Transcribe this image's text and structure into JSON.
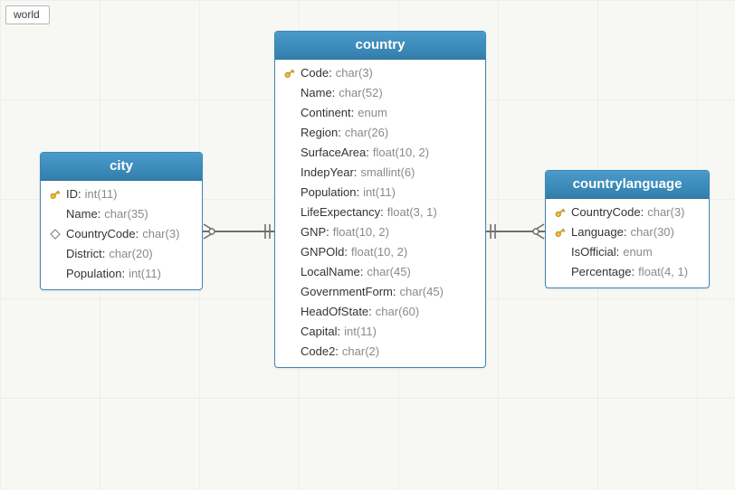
{
  "tab_label": "world",
  "colors": {
    "header": "#3b8ab8",
    "border": "#3f87b2"
  },
  "connectors": [
    {
      "from": "city.CountryCode",
      "to": "country.Code",
      "cardinality": "many-to-one"
    },
    {
      "from": "countrylanguage.CountryCode",
      "to": "country.Code",
      "cardinality": "many-to-one"
    }
  ],
  "entities": {
    "city": {
      "title": "city",
      "columns": [
        {
          "icon": "key",
          "name": "ID",
          "type": "int(11)"
        },
        {
          "icon": "none",
          "name": "Name",
          "type": "char(35)"
        },
        {
          "icon": "diamond",
          "name": "CountryCode",
          "type": "char(3)"
        },
        {
          "icon": "none",
          "name": "District",
          "type": "char(20)"
        },
        {
          "icon": "none",
          "name": "Population",
          "type": "int(11)"
        }
      ]
    },
    "country": {
      "title": "country",
      "columns": [
        {
          "icon": "key",
          "name": "Code",
          "type": "char(3)"
        },
        {
          "icon": "none",
          "name": "Name",
          "type": "char(52)"
        },
        {
          "icon": "none",
          "name": "Continent",
          "type": "enum"
        },
        {
          "icon": "none",
          "name": "Region",
          "type": "char(26)"
        },
        {
          "icon": "none",
          "name": "SurfaceArea",
          "type": "float(10, 2)"
        },
        {
          "icon": "none",
          "name": "IndepYear",
          "type": "smallint(6)"
        },
        {
          "icon": "none",
          "name": "Population",
          "type": "int(11)"
        },
        {
          "icon": "none",
          "name": "LifeExpectancy",
          "type": "float(3, 1)"
        },
        {
          "icon": "none",
          "name": "GNP",
          "type": "float(10, 2)"
        },
        {
          "icon": "none",
          "name": "GNPOld",
          "type": "float(10, 2)"
        },
        {
          "icon": "none",
          "name": "LocalName",
          "type": "char(45)"
        },
        {
          "icon": "none",
          "name": "GovernmentForm",
          "type": "char(45)"
        },
        {
          "icon": "none",
          "name": "HeadOfState",
          "type": "char(60)"
        },
        {
          "icon": "none",
          "name": "Capital",
          "type": "int(11)"
        },
        {
          "icon": "none",
          "name": "Code2",
          "type": "char(2)"
        }
      ]
    },
    "countrylanguage": {
      "title": "countrylanguage",
      "columns": [
        {
          "icon": "key",
          "name": "CountryCode",
          "type": "char(3)"
        },
        {
          "icon": "key",
          "name": "Language",
          "type": "char(30)"
        },
        {
          "icon": "none",
          "name": "IsOfficial",
          "type": "enum"
        },
        {
          "icon": "none",
          "name": "Percentage",
          "type": "float(4, 1)"
        }
      ]
    }
  }
}
